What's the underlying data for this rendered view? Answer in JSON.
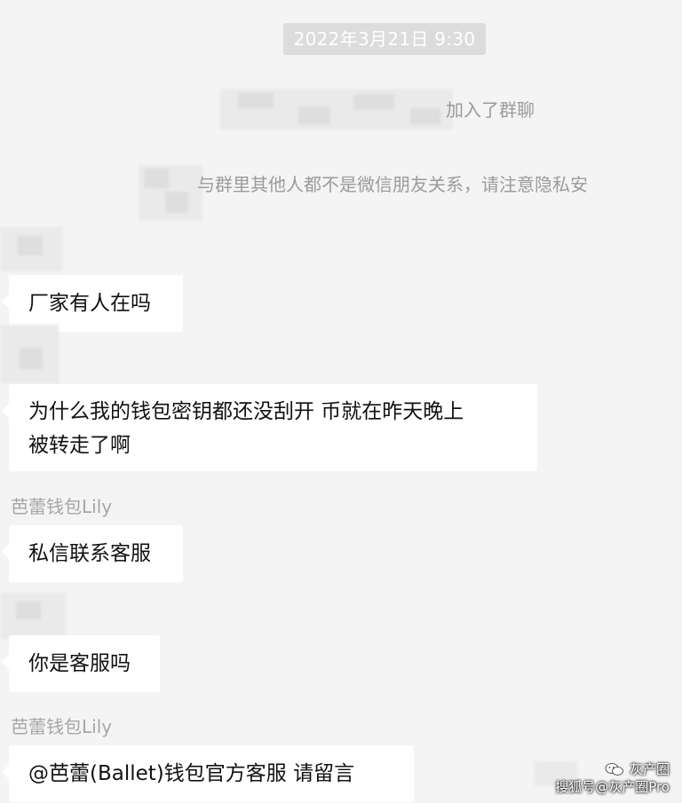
{
  "chat": {
    "timestamp": "2022年3月21日 9:30",
    "system": {
      "joined_text": "加入了群聊",
      "privacy_notice": "与群里其他人都不是微信朋友关系，请注意隐私安"
    },
    "messages": [
      {
        "sender": "",
        "text": "厂家有人在吗"
      },
      {
        "sender": "",
        "text_line1": "为什么我的钱包密钥都还没刮开 币就在昨天晚上",
        "text_line2": "被转走了啊"
      },
      {
        "sender": "芭蕾钱包Lily",
        "text": "私信联系客服"
      },
      {
        "sender": "",
        "text": "你是客服吗"
      },
      {
        "sender": "芭蕾钱包Lily",
        "text": "@芭蕾(Ballet)钱包官方客服 请留言"
      }
    ]
  },
  "watermark": {
    "line1": "灰产圈",
    "line2": "搜狐号@灰产圈Pro",
    "icon": "wechat-official-account-icon"
  },
  "colors": {
    "background": "#f4f4f4",
    "bubble": "#ffffff",
    "timestamp_bg": "#dcdcdc",
    "system_text": "#9b9b9b",
    "sender_text": "#a6a6a6"
  }
}
